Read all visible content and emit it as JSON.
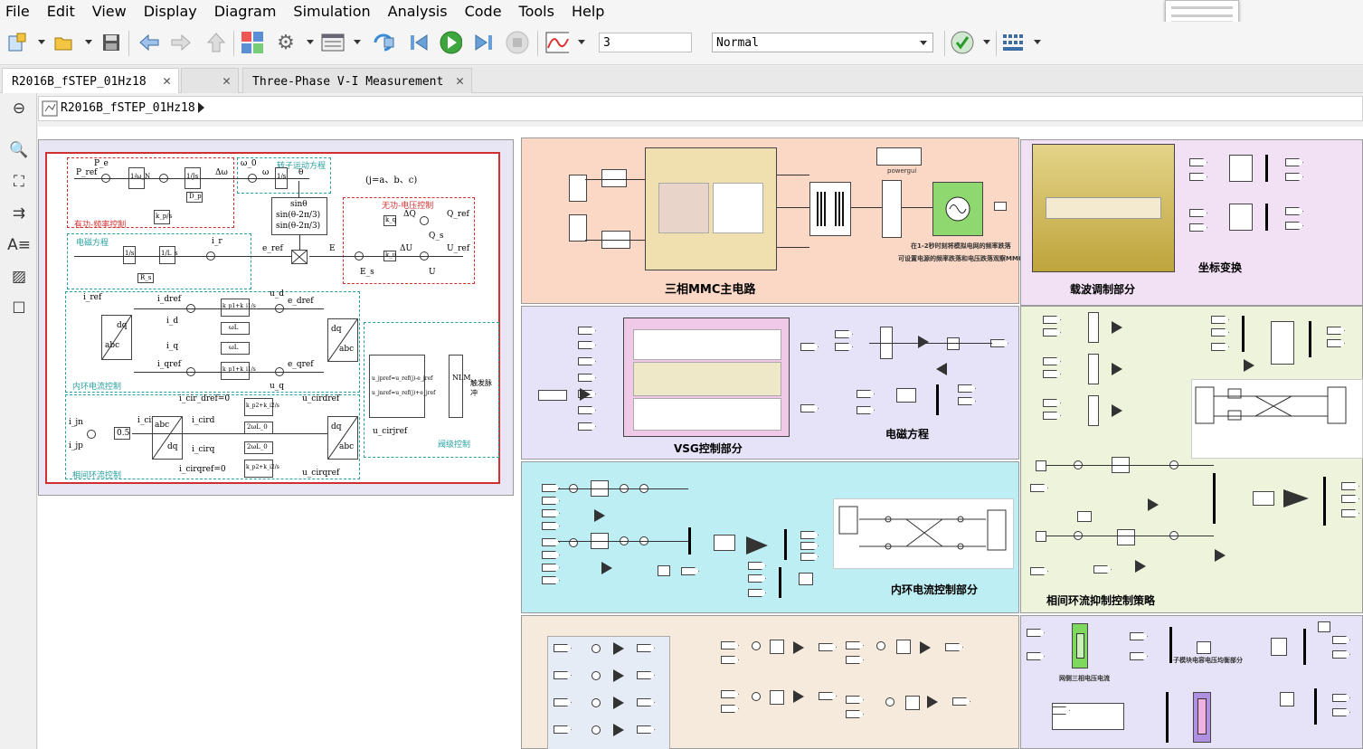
{
  "menu": [
    "File",
    "Edit",
    "View",
    "Display",
    "Diagram",
    "Simulation",
    "Analysis",
    "Code",
    "Tools",
    "Help"
  ],
  "toolbar": {
    "stop_time": "3",
    "sim_mode": "Normal",
    "icons": [
      "new-model-icon",
      "open-icon",
      "save-icon",
      "back-icon",
      "forward-icon",
      "up-icon",
      "library-browser-icon",
      "settings-gear-icon",
      "model-explorer-icon",
      "step-back-icon",
      "run-icon",
      "step-forward-icon",
      "stop-icon",
      "scope-icon",
      "check-icon",
      "build-icon"
    ]
  },
  "tabs": [
    {
      "label": "R2016B_fSTEP_01Hz18"
    },
    {
      "label": ""
    },
    {
      "label": "Three-Phase V-I Measurement"
    }
  ],
  "breadcrumb": "R2016B_fSTEP_01Hz18",
  "areas": {
    "mmc_main": "三相MMC主电路",
    "carrier": "载波调制部分",
    "coord": "坐标变换",
    "vsg": "VSG控制部分",
    "em_eq": "电磁方程",
    "inner_current": "内环电流控制部分",
    "circulating": "相间环流抑制控制策略",
    "powergui": "powergui",
    "note1": "在1-2秒时刻将模拟电网的频率跌落",
    "note2": "可设置电源的频率跌落和电压跌落观察MMC输出功率",
    "grid_side": "网侧三相电压电流",
    "submodule": "子模块电容电压均衡部分"
  },
  "diagram": {
    "labels": {
      "pref": "P_ref",
      "pe": "P_e",
      "inertia": "1/ω_N",
      "js": "1/Js",
      "dp": "D_p",
      "kp_s": "k_p/s",
      "delta_w": "Δω",
      "w0": "ω_0",
      "w": "ω",
      "one_s": "1/s",
      "theta": "θ",
      "rotor_eq": "转子运动方程",
      "jabc": "(j=a、b、c)",
      "sin1": "sinθ",
      "sin2": "sin(θ-2π/3)",
      "sin3": "sin(θ-2π/3)",
      "active": "有功-频率控制",
      "reactive": "无功-电压控制",
      "dq_label": "ΔQ",
      "qref": "Q_ref",
      "qs": "Q_s",
      "du": "ΔU",
      "uref": "U_ref",
      "u": "U",
      "kq": "k_q",
      "ku": "k_u",
      "e": "E",
      "es": "E_s",
      "eref": "e_ref",
      "em": "电磁方程",
      "ir": "i_r",
      "ls": "1/L_s",
      "rs": "R_s",
      "one_s2": "1/s",
      "iref": "i_ref",
      "dq": "dq",
      "abc": "abc",
      "idref": "i_dref",
      "id": "i_d",
      "iq": "i_q",
      "iqref": "i_qref",
      "pi1": "k_p1+k_i1/s",
      "wl": "ωL",
      "ud": "u_d",
      "uq": "u_q",
      "edref": "e_dref",
      "eqref": "e_qref",
      "inner": "内环电流控制",
      "uref_phase": "u_jpref=u_ref(j)-e_jref",
      "ujn": "u_jnref=u_ref(j)+e_jref",
      "nlm": "NLM",
      "trigger": "触发脉冲",
      "valve": "阀级控制",
      "icirdref": "i_cir_dref=0",
      "icird": "i_cird",
      "icirq": "i_cirq",
      "icirqref": "i_cirqref=0",
      "pi2": "k_p2+k_i2/s",
      "wl0": "2ωL_0",
      "ucirdref": "u_cirdref",
      "ucirqref": "u_cirqref",
      "ucirjref": "u_cirjref",
      "ijn": "i_jn",
      "ijp": "i_jp",
      "icir": "i_cir",
      "half": "0.5",
      "circ_ctrl": "相间环流控制"
    }
  },
  "colors": {
    "mmc_bg": "#fbd7c6",
    "carrier_bg": "#f2e1f5",
    "vsg_bg": "#e6e2f7",
    "inner_bg": "#bdeef3",
    "circ_bg": "#eef3dc",
    "bottom_bg": "#f5eadc",
    "grid_bg": "#e6e2f7",
    "diagram_bg": "#e8e6f4"
  }
}
